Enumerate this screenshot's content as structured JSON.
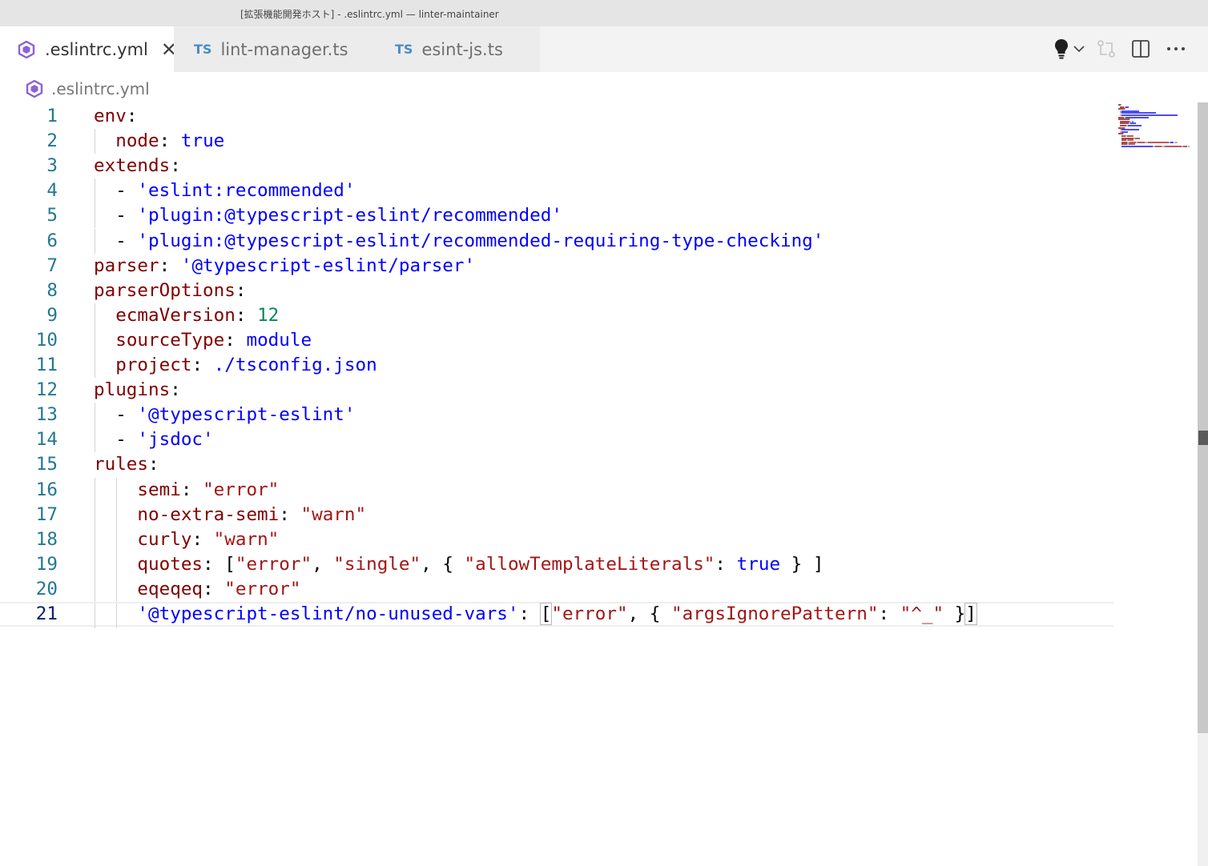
{
  "window": {
    "title": "[拡張機能開発ホスト] - .eslintrc.yml — linter-maintainer"
  },
  "tabs": [
    {
      "label": ".eslintrc.yml",
      "icon": "eslint-hexagon-icon",
      "active": true,
      "close": "✕"
    },
    {
      "label": "lint-manager.ts",
      "icon_text": "TS",
      "active": false
    },
    {
      "label": "esint-js.ts",
      "icon_text": "TS",
      "active": false
    }
  ],
  "tab_actions": [
    "lightbulb-icon",
    "chevron-down-icon",
    "compare-changes-icon",
    "split-editor-icon",
    "more-actions-icon"
  ],
  "breadcrumb": {
    "file": ".eslintrc.yml",
    "icon": "eslint-hexagon-icon"
  },
  "editor": {
    "current_line": 21,
    "lines": [
      {
        "n": "1",
        "code": [
          [
            "k",
            "env"
          ],
          [
            "p",
            ":"
          ]
        ]
      },
      {
        "n": "2",
        "code": [
          [
            "p",
            "  "
          ],
          [
            "k",
            "node"
          ],
          [
            "p",
            ": "
          ],
          [
            "b",
            "true"
          ]
        ]
      },
      {
        "n": "3",
        "code": [
          [
            "k",
            "extends"
          ],
          [
            "p",
            ":"
          ]
        ]
      },
      {
        "n": "4",
        "code": [
          [
            "p",
            "  - "
          ],
          [
            "s",
            "'eslint:recommended'"
          ]
        ]
      },
      {
        "n": "5",
        "code": [
          [
            "p",
            "  - "
          ],
          [
            "s",
            "'plugin:@typescript-eslint/recommended'"
          ]
        ]
      },
      {
        "n": "6",
        "code": [
          [
            "p",
            "  - "
          ],
          [
            "s",
            "'plugin:@typescript-eslint/recommended-requiring-type-checking'"
          ]
        ]
      },
      {
        "n": "7",
        "code": [
          [
            "k",
            "parser"
          ],
          [
            "p",
            ": "
          ],
          [
            "s",
            "'@typescript-eslint/parser'"
          ]
        ]
      },
      {
        "n": "8",
        "code": [
          [
            "k",
            "parserOptions"
          ],
          [
            "p",
            ":"
          ]
        ]
      },
      {
        "n": "9",
        "code": [
          [
            "p",
            "  "
          ],
          [
            "k",
            "ecmaVersion"
          ],
          [
            "p",
            ": "
          ],
          [
            "n",
            "12"
          ]
        ]
      },
      {
        "n": "10",
        "code": [
          [
            "p",
            "  "
          ],
          [
            "k",
            "sourceType"
          ],
          [
            "p",
            ": "
          ],
          [
            "s",
            "module"
          ]
        ]
      },
      {
        "n": "11",
        "code": [
          [
            "p",
            "  "
          ],
          [
            "k",
            "project"
          ],
          [
            "p",
            ": "
          ],
          [
            "s",
            "./tsconfig.json"
          ]
        ]
      },
      {
        "n": "12",
        "code": [
          [
            "k",
            "plugins"
          ],
          [
            "p",
            ":"
          ]
        ]
      },
      {
        "n": "13",
        "code": [
          [
            "p",
            "  - "
          ],
          [
            "s",
            "'@typescript-eslint'"
          ]
        ]
      },
      {
        "n": "14",
        "code": [
          [
            "p",
            "  - "
          ],
          [
            "s",
            "'jsdoc'"
          ]
        ]
      },
      {
        "n": "15",
        "code": [
          [
            "k",
            "rules"
          ],
          [
            "p",
            ":"
          ]
        ]
      },
      {
        "n": "16",
        "code": [
          [
            "p",
            "    "
          ],
          [
            "k",
            "semi"
          ],
          [
            "p",
            ": "
          ],
          [
            "r",
            "\"error\""
          ]
        ]
      },
      {
        "n": "17",
        "code": [
          [
            "p",
            "    "
          ],
          [
            "k",
            "no-extra-semi"
          ],
          [
            "p",
            ": "
          ],
          [
            "r",
            "\"warn\""
          ]
        ]
      },
      {
        "n": "18",
        "code": [
          [
            "p",
            "    "
          ],
          [
            "k",
            "curly"
          ],
          [
            "p",
            ": "
          ],
          [
            "r",
            "\"warn\""
          ]
        ]
      },
      {
        "n": "19",
        "code": [
          [
            "p",
            "    "
          ],
          [
            "k",
            "quotes"
          ],
          [
            "p",
            ": ["
          ],
          [
            "r",
            "\"error\""
          ],
          [
            "p",
            ", "
          ],
          [
            "r",
            "\"single\""
          ],
          [
            "p",
            ", { "
          ],
          [
            "r",
            "\"allowTemplateLiterals\""
          ],
          [
            "p",
            ": "
          ],
          [
            "b",
            "true"
          ],
          [
            "p",
            " } ]"
          ]
        ]
      },
      {
        "n": "20",
        "code": [
          [
            "p",
            "    "
          ],
          [
            "k",
            "eqeqeq"
          ],
          [
            "p",
            ": "
          ],
          [
            "r",
            "\"error\""
          ]
        ]
      },
      {
        "n": "21",
        "code": [
          [
            "p",
            "    "
          ],
          [
            "s",
            "'@typescript-eslint/no-unused-vars'"
          ],
          [
            "p",
            ": "
          ],
          [
            "pb",
            "["
          ],
          [
            "r",
            "\"error\""
          ],
          [
            "p",
            ", { "
          ],
          [
            "r",
            "\"argsIgnorePattern\""
          ],
          [
            "p",
            ": "
          ],
          [
            "r",
            "\"^_\""
          ],
          [
            "p",
            " }"
          ],
          [
            "pb",
            "]"
          ]
        ]
      }
    ]
  },
  "colors": {
    "key": "#800000",
    "string": "#0000ff",
    "quoted_string": "#a31515",
    "number": "#098658",
    "line_number": "#237893",
    "active_line_number": "#0b216f"
  }
}
